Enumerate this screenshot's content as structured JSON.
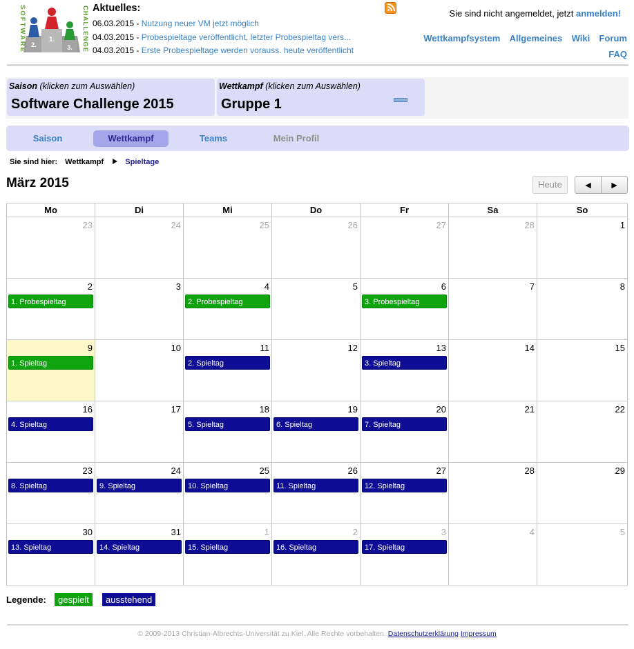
{
  "logo": {
    "alt_text": "SOFTWARE CHALLENGE"
  },
  "news": {
    "title": "Aktuelles:",
    "items": [
      {
        "date": "06.03.2015",
        "text": "Nutzung neuer VM jetzt möglich"
      },
      {
        "date": "04.03.2015",
        "text": "Probespieltage veröffentlicht, letzter Probespieltag vers..."
      },
      {
        "date": "04.03.2015",
        "text": "Erste Probespieltage werden vorauss. heute veröffentlicht"
      }
    ]
  },
  "icons": {
    "rss": "rss-feed-icon",
    "prev": "◄",
    "next": "►"
  },
  "login": {
    "text": "Sie sind nicht angemeldet, jetzt",
    "link": "anmelden!"
  },
  "topnav": [
    "Wettkampfsystem",
    "Allgemeines",
    "Wiki",
    "Forum",
    "FAQ"
  ],
  "selectors": {
    "saison": {
      "caption_bold": "Saison",
      "caption_hint": "(klicken zum Auswählen)",
      "value": "Software Challenge 2015"
    },
    "wettkampf": {
      "caption_bold": "Wettkampf",
      "caption_hint": "(klicken zum Auswählen)",
      "value": "Gruppe 1"
    }
  },
  "tabs": [
    {
      "label": "Saison",
      "state": "normal"
    },
    {
      "label": "Wettkampf",
      "state": "active"
    },
    {
      "label": "Teams",
      "state": "normal"
    },
    {
      "label": "Mein Profil",
      "state": "disabled"
    }
  ],
  "breadcrumb": {
    "prefix": "Sie sind hier:",
    "items": [
      "Wettkampf",
      "Spieltage"
    ]
  },
  "calendar": {
    "month_title": "März 2015",
    "today_label": "Heute",
    "weekdays": [
      "Mo",
      "Di",
      "Mi",
      "Do",
      "Fr",
      "Sa",
      "So"
    ],
    "weeks": [
      [
        {
          "day": "23",
          "other": true
        },
        {
          "day": "24",
          "other": true
        },
        {
          "day": "25",
          "other": true
        },
        {
          "day": "26",
          "other": true
        },
        {
          "day": "27",
          "other": true
        },
        {
          "day": "28",
          "other": true
        },
        {
          "day": "1"
        }
      ],
      [
        {
          "day": "2",
          "event": "1. Probespieltag",
          "status": "done"
        },
        {
          "day": "3"
        },
        {
          "day": "4",
          "event": "2. Probespieltag",
          "status": "done"
        },
        {
          "day": "5"
        },
        {
          "day": "6",
          "event": "3. Probespieltag",
          "status": "done"
        },
        {
          "day": "7"
        },
        {
          "day": "8"
        }
      ],
      [
        {
          "day": "9",
          "today": true,
          "event": "1. Spieltag",
          "status": "done"
        },
        {
          "day": "10"
        },
        {
          "day": "11",
          "event": "2. Spieltag",
          "status": "open"
        },
        {
          "day": "12"
        },
        {
          "day": "13",
          "event": "3. Spieltag",
          "status": "open"
        },
        {
          "day": "14"
        },
        {
          "day": "15"
        }
      ],
      [
        {
          "day": "16",
          "event": "4. Spieltag",
          "status": "open"
        },
        {
          "day": "17"
        },
        {
          "day": "18",
          "event": "5. Spieltag",
          "status": "open"
        },
        {
          "day": "19",
          "event": "6. Spieltag",
          "status": "open"
        },
        {
          "day": "20",
          "event": "7. Spieltag",
          "status": "open"
        },
        {
          "day": "21"
        },
        {
          "day": "22"
        }
      ],
      [
        {
          "day": "23",
          "event": "8. Spieltag",
          "status": "open"
        },
        {
          "day": "24",
          "event": "9. Spieltag",
          "status": "open"
        },
        {
          "day": "25",
          "event": "10. Spieltag",
          "status": "open"
        },
        {
          "day": "26",
          "event": "11. Spieltag",
          "status": "open"
        },
        {
          "day": "27",
          "event": "12. Spieltag",
          "status": "open"
        },
        {
          "day": "28"
        },
        {
          "day": "29"
        }
      ],
      [
        {
          "day": "30",
          "event": "13. Spieltag",
          "status": "open"
        },
        {
          "day": "31",
          "event": "14. Spieltag",
          "status": "open"
        },
        {
          "day": "1",
          "other": true,
          "event": "15. Spieltag",
          "status": "open"
        },
        {
          "day": "2",
          "other": true,
          "event": "16. Spieltag",
          "status": "open"
        },
        {
          "day": "3",
          "other": true,
          "event": "17. Spieltag",
          "status": "open"
        },
        {
          "day": "4",
          "other": true
        },
        {
          "day": "5",
          "other": true
        }
      ]
    ]
  },
  "legend": {
    "label": "Legende:",
    "done": "gespielt",
    "open": "ausstehend"
  },
  "colors": {
    "done": "#0fa30f",
    "open": "#0d0d96",
    "today_bg": "#fcf8c8",
    "link": "#3b82c4"
  },
  "footer": {
    "copyright": "© 2009-2013 Christian-Albrechts-Universität zu Kiel. Alle Rechte vorbehalten.",
    "links": [
      "Datenschutzerklärung",
      "Impressum"
    ]
  }
}
